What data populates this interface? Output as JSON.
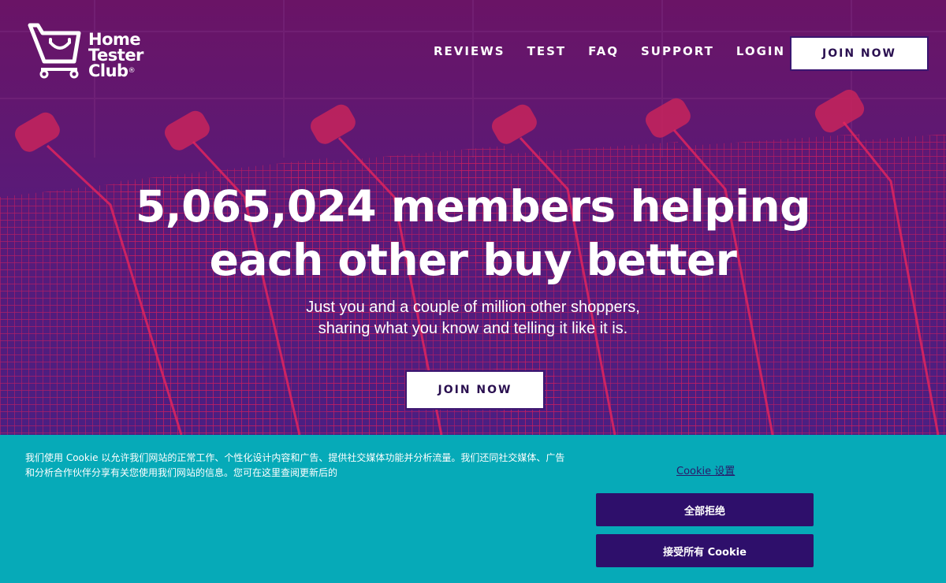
{
  "header": {
    "logo": {
      "line1": "Home",
      "line2": "Tester",
      "line3": "Club",
      "reg_mark": "®",
      "icon": "shopping-cart-icon"
    },
    "nav": [
      {
        "label": "REVIEWS"
      },
      {
        "label": "TEST"
      },
      {
        "label": "FAQ"
      },
      {
        "label": "SUPPORT"
      },
      {
        "label": "LOGIN"
      }
    ],
    "join_label": "JOIN NOW"
  },
  "hero": {
    "headline_line1": "5,065,024 members helping",
    "headline_line2": "each other buy better",
    "subline_line1": "Just you and a couple of million other shoppers,",
    "subline_line2": "sharing what you know and telling it like it is.",
    "cta_label": "JOIN NOW",
    "background": "shopping-carts-photo"
  },
  "cookie_banner": {
    "text": "我们使用 Cookie 以允许我们网站的正常工作、个性化设计内容和广告、提供社交媒体功能并分析流量。我们还同社交媒体、广告和分析合作伙伴分享有关您使用我们网站的信息。您可在这里查阅更新后的",
    "settings_label": "Cookie 设置",
    "reject_label": "全部拒绝",
    "accept_label": "接受所有 Cookie"
  },
  "colors": {
    "hero_overlay": "#5a1a78",
    "cart_accent": "#e0245e",
    "cookie_bg": "#06aab8",
    "button_dark": "#2e0f6b",
    "text_white": "#ffffff"
  }
}
